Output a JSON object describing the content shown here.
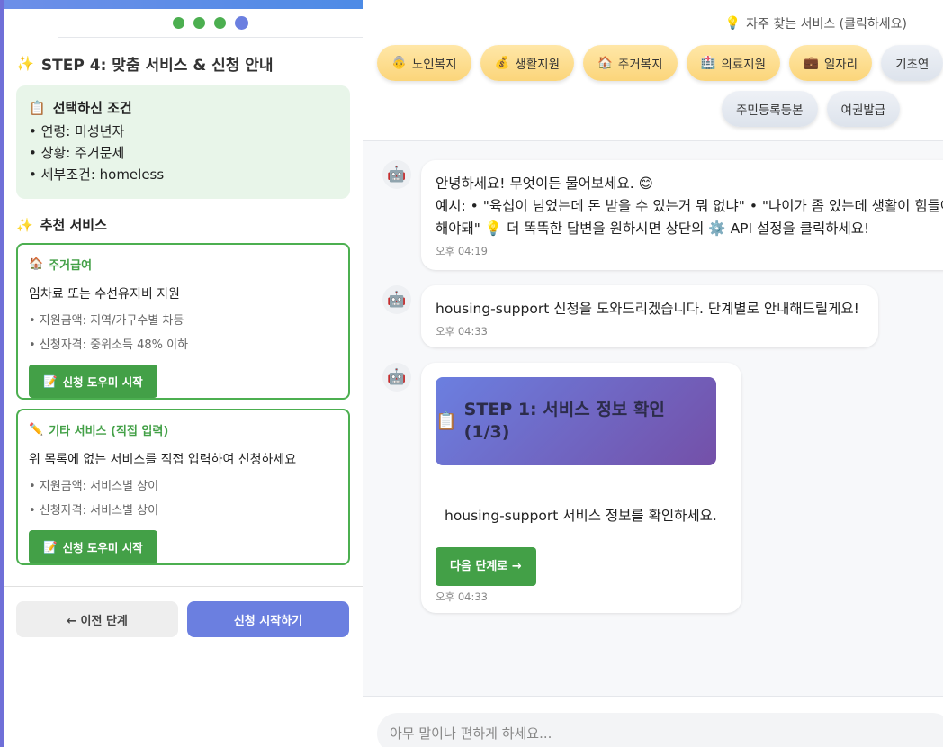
{
  "wizard": {
    "step_title": "STEP 4: 맞춤 서비스 & 신청 안내",
    "sparkle_icon": "✨",
    "conditions": {
      "icon": "📋",
      "title": "선택하신 조건",
      "rows": [
        "• 연령: 미성년자",
        "• 상황: 주거문제",
        "• 세부조건: homeless"
      ]
    },
    "recommended_title": "추천 서비스",
    "services": [
      {
        "icon": "🏠",
        "name": "주거급여",
        "desc": "임차료 또는 수선유지비 지원",
        "amount": "• 지원금액: 지역/가구수별 차등",
        "eligibility": "• 신청자격: 중위소득 48% 이하",
        "button": "신청 도우미 시작",
        "button_icon": "📝"
      },
      {
        "icon": "✏️",
        "name": "기타 서비스 (직접 입력)",
        "desc": "위 목록에 없는 서비스를 직접 입력하여 신청하세요",
        "amount": "• 지원금액: 서비스별 상이",
        "eligibility": "• 신청자격: 서비스별 상이",
        "button": "신청 도우미 시작",
        "button_icon": "📝"
      }
    ],
    "prev_button": "← 이전 단계",
    "start_button": "신청 시작하기"
  },
  "quick": {
    "title": "자주 찾는 서비스 (클릭하세요)",
    "title_icon": "💡",
    "chips": [
      {
        "icon": "👵",
        "label": "노인복지"
      },
      {
        "icon": "💰",
        "label": "생활지원"
      },
      {
        "icon": "🏠",
        "label": "주거복지"
      },
      {
        "icon": "🏥",
        "label": "의료지원"
      },
      {
        "icon": "💼",
        "label": "일자리"
      },
      {
        "icon": "",
        "label": "기초연"
      }
    ],
    "chips2": [
      "주민등록등본",
      "여권발급"
    ]
  },
  "chat": {
    "bot_icon": "🤖",
    "messages": [
      {
        "line1": "안녕하세요! 무엇이든 물어보세요. 😊",
        "line2": "예시: • \"육십이 넘었는데 돈 받을 수 있는거 뭐 없냐\" • \"나이가 좀 있는데 생활이 힘들어",
        "line3": "해야돼\" 💡 더 똑똑한 답변을 원하시면 상단의 ⚙️ API 설정을 클릭하세요!",
        "time": "오후 04:19"
      },
      {
        "text": "housing-support 신청을 도와드리겠습니다. 단계별로 안내해드릴게요!",
        "time": "오후 04:33"
      },
      {
        "card_icon": "📋",
        "card_title": "STEP 1: 서비스 정보 확인 (1/3)",
        "text": "housing-support 서비스 정보를 확인하세요.",
        "button": "다음 단계로 →",
        "time": "오후 04:33"
      }
    ]
  },
  "composer": {
    "placeholder": "아무 말이나 편하게 하세요..."
  }
}
